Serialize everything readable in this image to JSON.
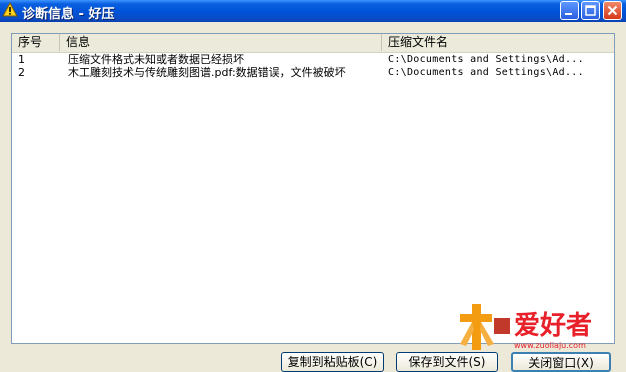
{
  "window": {
    "title": "诊断信息 - 好压",
    "title_icon": "warning-icon"
  },
  "list": {
    "columns": [
      "序号",
      "信息",
      "压缩文件名"
    ],
    "rows": [
      {
        "index": "1",
        "message": "压缩文件格式未知或者数据已经损坏",
        "archive": "C:\\Documents and Settings\\Ad..."
      },
      {
        "index": "2",
        "message": "木工雕刻技术与传统雕刻图谱.pdf:数据错误，文件被破坏",
        "archive": "C:\\Documents and Settings\\Ad..."
      }
    ]
  },
  "buttons": {
    "copy": "复制到粘贴板(C)",
    "save": "保存到文件(S)",
    "close": "关闭窗口(X)"
  },
  "watermark": {
    "text": "爱好者",
    "url": "www.zuoliaju.com"
  },
  "colors": {
    "titlebar": "#0053d8",
    "window_bg": "#ECE9D8",
    "watermark_red": "#e8202a",
    "watermark_orange": "#f39c12"
  }
}
